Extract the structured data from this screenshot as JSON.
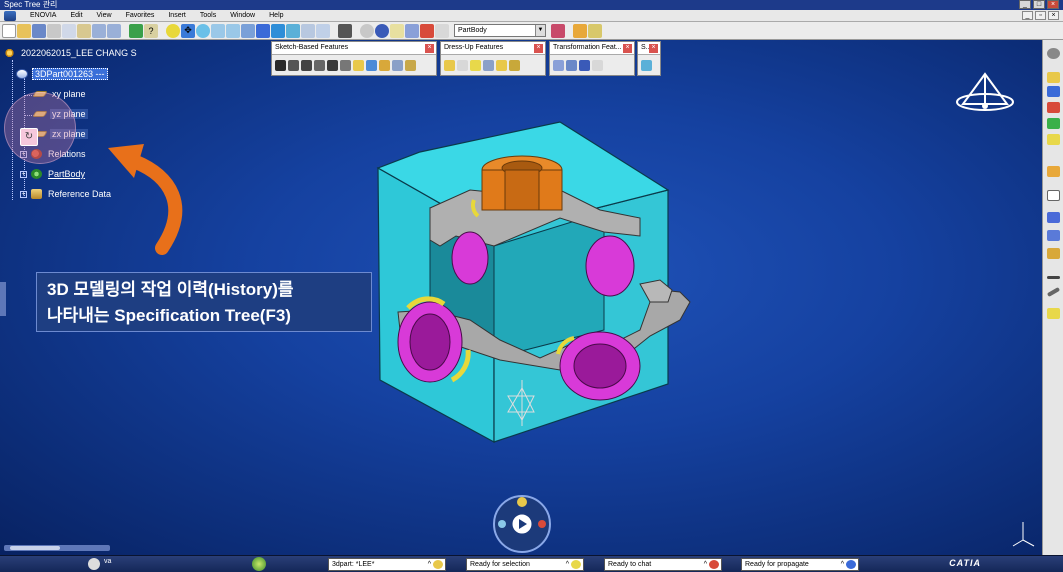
{
  "window": {
    "title": "Spec Tree 관리"
  },
  "menubar": {
    "items": [
      "ENOVIA",
      "Edit",
      "View",
      "Favorites",
      "Insert",
      "Tools",
      "Window",
      "Help"
    ]
  },
  "toolbar": {
    "part_selector_value": "PartBody"
  },
  "tree": {
    "root_label": "2022062015_LEE CHANG S",
    "part_label": "3DPart001263 ---",
    "nodes": [
      {
        "label": "xy plane",
        "icon": "plane-icon"
      },
      {
        "label": "yz plane",
        "icon": "plane-icon"
      },
      {
        "label": "zx plane",
        "icon": "plane-icon"
      },
      {
        "label": "Relations",
        "icon": "relations-icon"
      },
      {
        "label": "PartBody",
        "icon": "partbody-icon"
      },
      {
        "label": "Reference Data",
        "icon": "reference-data-icon"
      }
    ]
  },
  "callout": {
    "line1": "3D 모델링의 작업 이력(History)를",
    "line2": "나타내는 Specification Tree(F3)"
  },
  "floating_toolbars": [
    {
      "title": "Sketch-Based Features"
    },
    {
      "title": "Dress-Up Features"
    },
    {
      "title": "Transformation Feat..."
    },
    {
      "title": "S..."
    }
  ],
  "taskbar": {
    "user": "va",
    "doc_tab": "3dpart: *LEE*",
    "status_selection": "Ready for selection",
    "status_chat": "Ready to chat",
    "status_propagate": "Ready for propagate",
    "brand": "CATIA"
  },
  "colors": {
    "viewport_bg": "#1541a0",
    "model_cyan": "#2ec8d8",
    "model_magenta": "#d83ad8",
    "model_orange": "#e07a1a",
    "model_gray": "#a8a8a8",
    "model_yellow": "#e8d83a",
    "callout_bg": "#1e3e82",
    "arrow_orange": "#e8701a"
  }
}
